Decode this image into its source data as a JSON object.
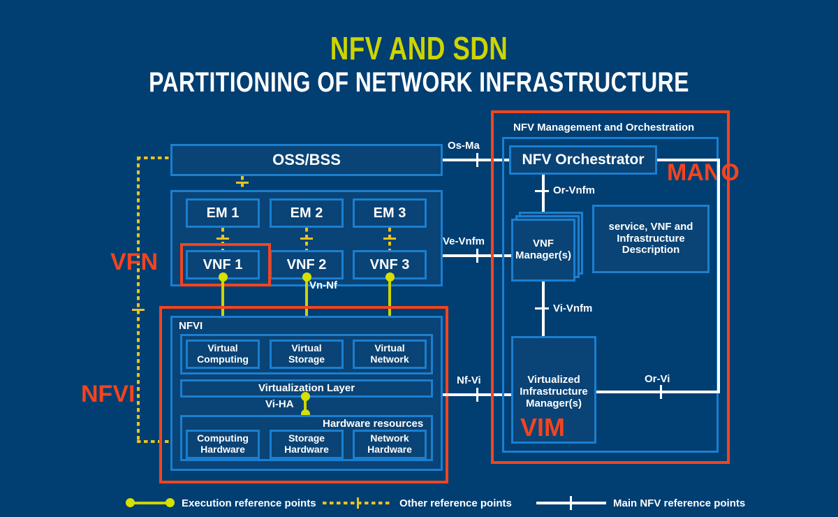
{
  "title": {
    "line1": "NFV AND SDN",
    "line2": "PARTITIONING OF NETWORK INFRASTRUCTURE"
  },
  "colors": {
    "background": "#013e72",
    "panel": "#0a4375",
    "border_blue": "#1b7fd0",
    "accent_orange": "#f4441e",
    "title_yellow": "#cdd400",
    "exec_line": "#cdd400",
    "other_line": "#e8c420",
    "main_line": "#ffffff"
  },
  "left": {
    "oss_bss": "OSS/BSS",
    "em": [
      "EM 1",
      "EM 2",
      "EM 3"
    ],
    "vnf": [
      "VNF 1",
      "VNF 2",
      "VNF 3"
    ],
    "vn_nf_label": "Vn-Nf",
    "vfn_label": "VFN",
    "nfvi_badge": "NFVI",
    "nfvi_title": "NFVI",
    "virtual_resources": [
      "Virtual\nComputing",
      "Virtual\nStorage",
      "Virtual\nNetwork"
    ],
    "virtual_computing": "Virtual Computing",
    "virtual_storage": "Virtual Storage",
    "virtual_network": "Virtual Network",
    "virtualization_layer": "Virtualization Layer",
    "vi_ha_label": "Vi-HA",
    "hardware_resources_title": "Hardware resources",
    "computing_hardware": "Computing Hardware",
    "storage_hardware": "Storage Hardware",
    "network_hardware": "Network Hardware"
  },
  "right": {
    "mano_title": "NFV Management and Orchestration",
    "mano_label": "MANO",
    "orchestrator": "NFV Orchestrator",
    "vnf_manager": "VNF Manager(s)",
    "description_box": "service, VNF and Infrastructure Description",
    "vim_box": "Virtualized Infrastructure Manager(s)",
    "vim_label": "VIM",
    "or_vnfm": "Or-Vnfm",
    "vi_vnfm": "Vi-Vnfm",
    "or_vi": "Or-Vi"
  },
  "reference_points": {
    "os_ma": "Os-Ma",
    "ve_vnfm": "Ve-Vnfm",
    "nf_vi": "Nf-Vi"
  },
  "legend": {
    "execution": "Execution reference points",
    "other": "Other reference points",
    "main": "Main NFV reference points"
  }
}
